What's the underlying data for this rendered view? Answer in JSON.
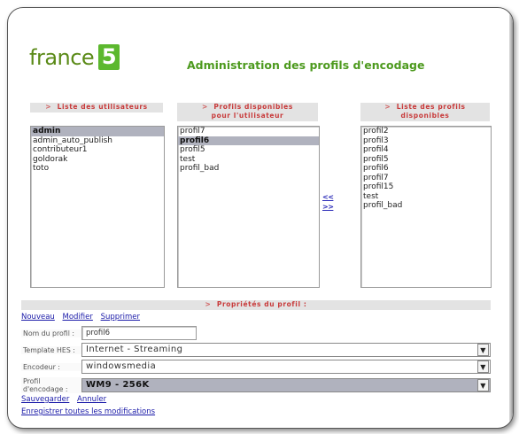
{
  "logo": {
    "text": "france",
    "numeral": "5"
  },
  "title": "Administration des profils d'encodage",
  "users_panel": {
    "arrow": ">",
    "header": "Liste des utilisateurs",
    "items": [
      "admin",
      "admin_auto_publish",
      "contributeur1",
      "goldorak",
      "toto"
    ],
    "selected_index": 0
  },
  "user_profiles_panel": {
    "arrow": ">",
    "header_line1": "Profils disponibles",
    "header_line2": "pour l'utilisateur",
    "items": [
      "profil7",
      "profil6",
      "profil5",
      "test",
      "profil_bad"
    ],
    "selected_index": 1
  },
  "move_buttons": {
    "left": "<<",
    "right": ">>"
  },
  "all_profiles_panel": {
    "arrow": ">",
    "header_line1": "Liste des profils",
    "header_line2": "disponibles",
    "items": [
      "profil2",
      "profil3",
      "profil4",
      "profil5",
      "profil6",
      "profil7",
      "profil15",
      "test",
      "profil_bad"
    ]
  },
  "properties": {
    "arrow": ">",
    "header": "Propriétés du profil :",
    "actions": {
      "new": "Nouveau",
      "edit": "Modifier",
      "delete": "Supprimer"
    },
    "name_label": "Nom du profil :",
    "name_value": "profil6",
    "template_label": "Template HES :",
    "template_value": "Internet - Streaming",
    "encoder_label": "Encodeur :",
    "encoder_value": "windowsmedia",
    "encoding_label": "Profil d'encodage :",
    "encoding_value": "WM9 - 256K",
    "save": "Sauvegarder",
    "cancel": "Annuler",
    "save_all": "Enregistrer toutes les modifications"
  },
  "icons": {
    "dropdown": "chevron-down-icon"
  }
}
